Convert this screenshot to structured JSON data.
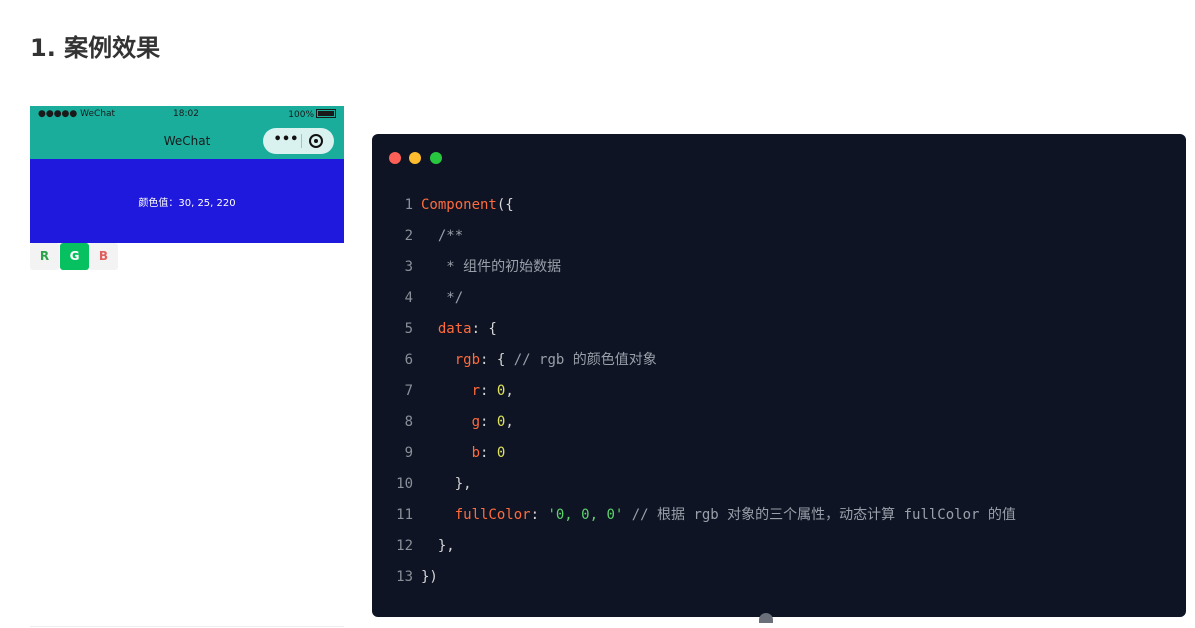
{
  "page": {
    "title": "1. 案例效果"
  },
  "phone": {
    "status_left": "●●●●● WeChat",
    "time": "18:02",
    "battery": "100%",
    "nav_title": "WeChat",
    "color_bg": "#1e19dc",
    "color_text": "颜色值：30, 25, 220",
    "buttons": {
      "r": "R",
      "g": "G",
      "b": "B"
    }
  },
  "code": {
    "lines": [
      {
        "n": "1",
        "parts": [
          [
            "kw",
            "Component"
          ],
          [
            "p",
            "({"
          ]
        ]
      },
      {
        "n": "2",
        "parts": [
          [
            "cm",
            "  /**"
          ]
        ]
      },
      {
        "n": "3",
        "parts": [
          [
            "cm",
            "   * 组件的初始数据"
          ]
        ]
      },
      {
        "n": "4",
        "parts": [
          [
            "cm",
            "   */"
          ]
        ]
      },
      {
        "n": "5",
        "parts": [
          [
            "p",
            "  "
          ],
          [
            "kw",
            "data"
          ],
          [
            "p",
            ": {"
          ]
        ]
      },
      {
        "n": "6",
        "parts": [
          [
            "p",
            "    "
          ],
          [
            "kw",
            "rgb"
          ],
          [
            "p",
            ": { "
          ],
          [
            "cm",
            "// rgb 的颜色值对象"
          ]
        ]
      },
      {
        "n": "7",
        "parts": [
          [
            "p",
            "      "
          ],
          [
            "kw",
            "r"
          ],
          [
            "p",
            ": "
          ],
          [
            "num",
            "0"
          ],
          [
            "p",
            ","
          ]
        ]
      },
      {
        "n": "8",
        "parts": [
          [
            "p",
            "      "
          ],
          [
            "kw",
            "g"
          ],
          [
            "p",
            ": "
          ],
          [
            "num",
            "0"
          ],
          [
            "p",
            ","
          ]
        ]
      },
      {
        "n": "9",
        "parts": [
          [
            "p",
            "      "
          ],
          [
            "kw",
            "b"
          ],
          [
            "p",
            ": "
          ],
          [
            "num",
            "0"
          ]
        ]
      },
      {
        "n": "10",
        "parts": [
          [
            "p",
            "    },"
          ]
        ]
      },
      {
        "n": "11",
        "parts": [
          [
            "p",
            "    "
          ],
          [
            "kw",
            "fullColor"
          ],
          [
            "p",
            ": "
          ],
          [
            "str",
            "'0, 0, 0'"
          ],
          [
            "p",
            " "
          ],
          [
            "cm",
            "// 根据 rgb 对象的三个属性，动态计算 fullColor 的值"
          ]
        ]
      },
      {
        "n": "12",
        "parts": [
          [
            "p",
            "  },"
          ]
        ]
      },
      {
        "n": "13",
        "parts": [
          [
            "p",
            "})"
          ]
        ]
      }
    ]
  },
  "colors": {
    "header_teal": "#1aad9c",
    "green_button": "#07c160",
    "code_bg": "#0e1423",
    "keyword": "#ff6b3d",
    "string": "#5dd36e",
    "number": "#dfe35a"
  }
}
